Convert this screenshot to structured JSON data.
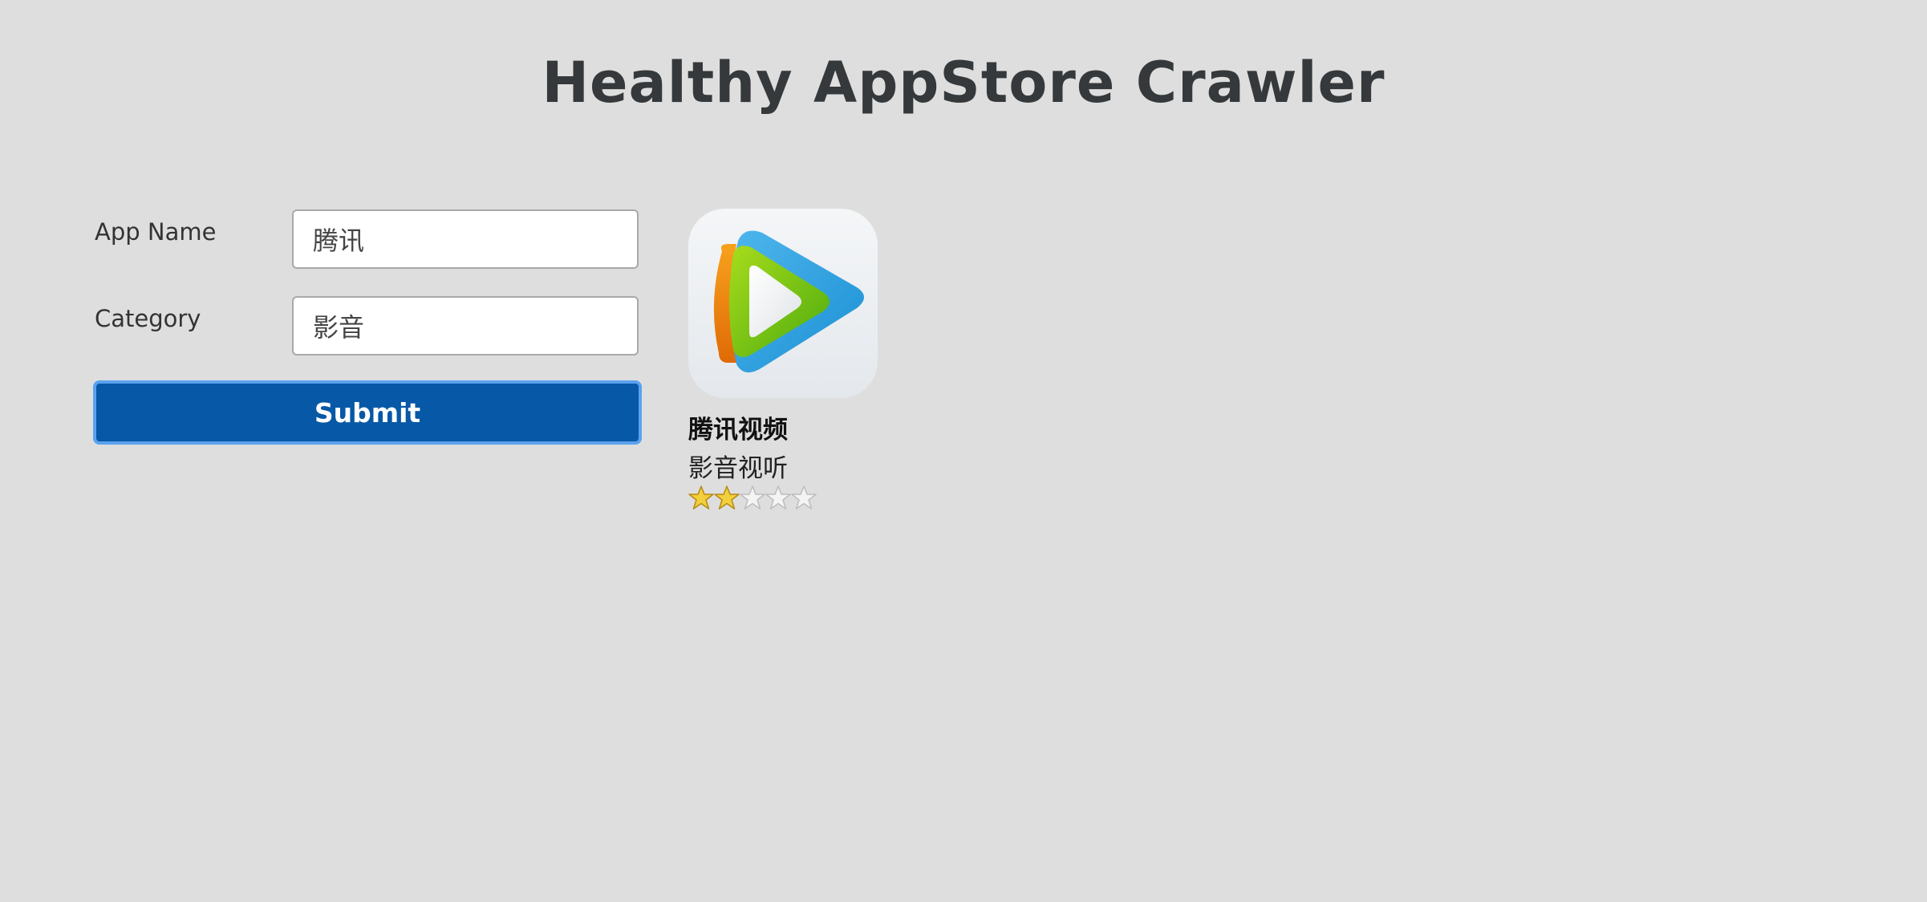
{
  "page": {
    "title": "Healthy AppStore Crawler"
  },
  "form": {
    "app_name_label": "App Name",
    "app_name_value": "腾讯",
    "category_label": "Category",
    "category_value": "影音",
    "submit_label": "Submit"
  },
  "result": {
    "app_name": "腾讯视频",
    "category": "影音视听",
    "icon": "tencent-video-play-icon",
    "rating": 2,
    "rating_max": 5
  },
  "colors": {
    "background": "#dedede",
    "submit_fill": "#0758a6",
    "submit_border": "#5aa2ef",
    "star_filled": "#f2cf3b",
    "star_empty": "#f4f4f4"
  }
}
